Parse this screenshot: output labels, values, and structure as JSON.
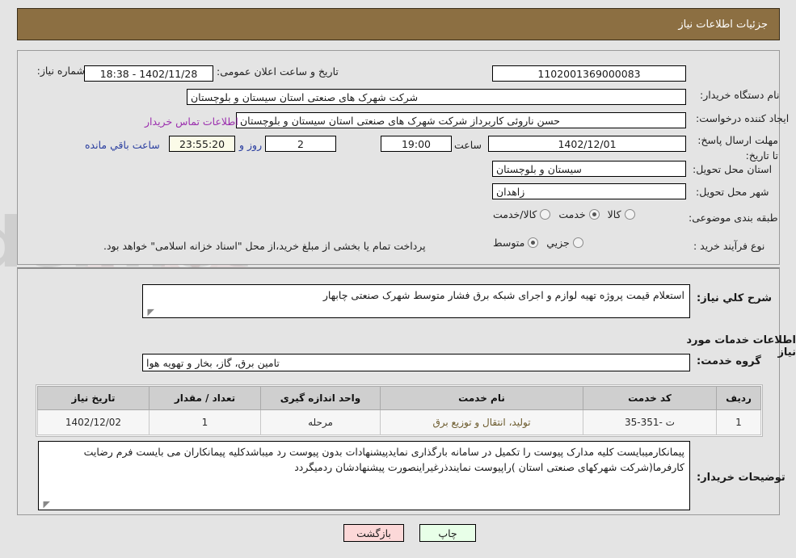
{
  "header": {
    "title": "جزئیات اطلاعات نیاز"
  },
  "top_panel": {
    "need_number_label": "شماره نیاز:",
    "need_number_value": "1102001369000083",
    "announce_datetime_label": "تاریخ و ساعت اعلان عمومی:",
    "announce_datetime_value": "1402/11/28 - 18:38",
    "buyer_org_label": "نام دستگاه خریدار:",
    "buyer_org_value": "شرکت شهرک های صنعتی استان سیستان و بلوچستان",
    "creator_label": "ایجاد کننده درخواست:",
    "creator_value": "حسن ناروئی کاربرداز شرکت شهرک های صنعتی استان سیستان و بلوچستان",
    "contact_link": "اطلاعات تماس خریدار",
    "deadline_label": "مهلت ارسال پاسخ: تا تاریخ:",
    "deadline_date": "1402/12/01",
    "deadline_hour_label": "ساعت",
    "deadline_hour_value": "19:00",
    "days_value": "2",
    "days_label": "روز و",
    "countdown_value": "23:55:20",
    "countdown_label": "ساعت باقي مانده",
    "province_label": "استان محل تحویل:",
    "province_value": "سیستان و بلوچستان",
    "city_label": "شهر محل تحویل:",
    "city_value": "زاهدان",
    "category_label": "طبقه بندی موضوعی:",
    "category_options": [
      {
        "label": "کالا",
        "selected": false
      },
      {
        "label": "خدمت",
        "selected": true
      },
      {
        "label": "کالا/خدمت",
        "selected": false
      }
    ],
    "process_label": "نوع فرآیند خرید :",
    "process_options": [
      {
        "label": "جزیي",
        "selected": false
      },
      {
        "label": "متوسط",
        "selected": true
      }
    ],
    "treasury_note": "پرداخت تمام یا بخشی از مبلغ خرید،از محل \"اسناد خزانه اسلامی\" خواهد بود."
  },
  "bottom_panel": {
    "general_desc_label": "شرح كلي نياز:",
    "general_desc_value": "استعلام قیمت پروژه تهیه لوازم و اجرای شبکه برق فشار متوسط   شهرک صنعتی چابهار",
    "services_heading": "اطلاعات خدمات مورد نیاز",
    "service_group_label": "گروه خدمت:",
    "service_group_value": "تامین برق، گاز، بخار و تهویه هوا",
    "buyer_notes_label": "توضیحات خریدار:",
    "buyer_notes_value": "پیمانکارمیبایست کلیه مدارک پیوست را تکمیل در سامانه بارگذاری نمایدپیشنهادات بدون پیوست رد میباشدکلیه پیمانکاران می بایست فرم رضایت کارفرما(شرکت شهرکهای صنعتی استان )راپیوست نمایندذرغیراینصورت پیشنهادشان ردمیگردد"
  },
  "table": {
    "headers": [
      "ردیف",
      "کد خدمت",
      "نام خدمت",
      "واحد اندازه گیری",
      "تعداد / مقدار",
      "تاریخ نیاز"
    ],
    "rows": [
      {
        "row_no": "1",
        "service_code": "ت -351-35",
        "service_name": "تولید، انتقال و توزیع برق",
        "unit": "مرحله",
        "quantity": "1",
        "need_date": "1402/12/02"
      }
    ]
  },
  "footer": {
    "print_label": "چاپ",
    "back_label": "بازگشت"
  },
  "colors": {
    "header_brown": "#8c6f42",
    "link_purple": "#9b2fae",
    "countdown_cream": "#fbfbe8",
    "print_green": "#e8ffe8",
    "back_pink": "#fcd8d8",
    "page_gray": "#e4e4e4"
  },
  "watermark": {
    "text": "AriaTender.net"
  }
}
